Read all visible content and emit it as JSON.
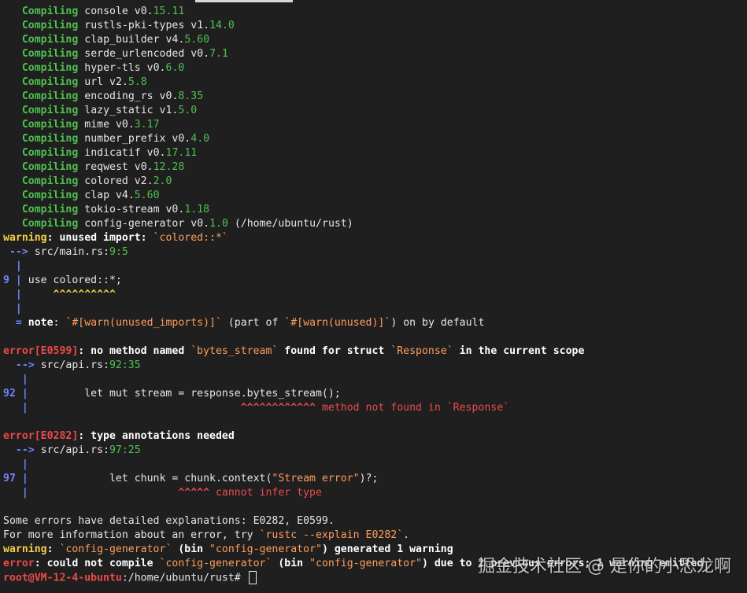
{
  "compile_lines": [
    {
      "word": "Compiling",
      "name": "console",
      "pre": "v0.",
      "post": "15.11"
    },
    {
      "word": "Compiling",
      "name": "rustls-pki-types",
      "pre": "v1.",
      "post": "14.0"
    },
    {
      "word": "Compiling",
      "name": "clap_builder",
      "pre": "v4.",
      "post": "5.60"
    },
    {
      "word": "Compiling",
      "name": "serde_urlencoded",
      "pre": "v0.",
      "post": "7.1"
    },
    {
      "word": "Compiling",
      "name": "hyper-tls",
      "pre": "v0.",
      "post": "6.0"
    },
    {
      "word": "Compiling",
      "name": "url",
      "pre": "v2.",
      "post": "5.8"
    },
    {
      "word": "Compiling",
      "name": "encoding_rs",
      "pre": "v0.",
      "post": "8.35"
    },
    {
      "word": "Compiling",
      "name": "lazy_static",
      "pre": "v1.",
      "post": "5.0"
    },
    {
      "word": "Compiling",
      "name": "mime",
      "pre": "v0.",
      "post": "3.17"
    },
    {
      "word": "Compiling",
      "name": "number_prefix",
      "pre": "v0.",
      "post": "4.0"
    },
    {
      "word": "Compiling",
      "name": "indicatif",
      "pre": "v0.",
      "post": "17.11"
    },
    {
      "word": "Compiling",
      "name": "reqwest",
      "pre": "v0.",
      "post": "12.28"
    },
    {
      "word": "Compiling",
      "name": "colored",
      "pre": "v2.",
      "post": "2.0"
    },
    {
      "word": "Compiling",
      "name": "clap",
      "pre": "v4.",
      "post": "5.60"
    },
    {
      "word": "Compiling",
      "name": "tokio-stream",
      "pre": "v0.",
      "post": "1.18"
    },
    {
      "word": "Compiling",
      "name": "config-generator",
      "pre": "v0.",
      "post": "1.0",
      "extra": " (/home/ubuntu/rust)"
    }
  ],
  "warning1": {
    "label": "warning",
    "msg": ": unused import: ",
    "code": "`colored::*`",
    "arrow": " --> ",
    "loc_file": "src/main.rs:",
    "loc_pos": "9:5",
    "gutter": "  |",
    "lineno": "9 | ",
    "src": "use colored::*;",
    "gutter2": "  |",
    "carets": "     ^^^^^^^^^^",
    "gutter3": "  |",
    "note_eq": "  = ",
    "note_label": "note",
    "note_a": ": ",
    "note_code1": "`#[warn(unused_imports)]`",
    "note_b": " (part of ",
    "note_code2": "`#[warn(unused)]`",
    "note_c": ") on by default"
  },
  "error1": {
    "label": "error[E0599]",
    "msg_a": ": no method named ",
    "code1": "`bytes_stream`",
    "msg_b": " found for struct ",
    "code2": "`Response`",
    "msg_c": " in the current scope",
    "arrow": "  --> ",
    "loc_file": "src/api.rs:",
    "loc_pos": "92:35",
    "gutter": "   |",
    "lineno": "92 | ",
    "src": "        let mut stream = response.bytes_stream();",
    "gutter2": "   |",
    "carets": "                                  ^^^^^^^^^^^^",
    "caret_msg": " method not found in `Response`"
  },
  "error2": {
    "label": "error[E0282]",
    "msg": ": type annotations needed",
    "arrow": "  --> ",
    "loc_file": "src/api.rs:",
    "loc_pos": "97:25",
    "gutter": "   |",
    "lineno": "97 | ",
    "src": "            let chunk = chunk.context(",
    "src_str": "\"Stream error\"",
    "src_end": ")?;",
    "gutter2": "   |",
    "carets": "                        ^^^^^",
    "caret_msg": " cannot infer type"
  },
  "summary": {
    "line1": "Some errors have detailed explanations: E0282, E0599.",
    "line2_a": "For more information about an error, try ",
    "line2_code": "`rustc --explain E0282`",
    "line2_b": ".",
    "warn_label": "warning",
    "warn_a": ": ",
    "warn_code": "`config-generator`",
    "warn_b": " (bin ",
    "warn_str": "\"config-generator\"",
    "warn_c": ") generated 1 warning",
    "err_label": "error",
    "err_a": ": could not compile ",
    "err_code": "`config-generator`",
    "err_b": " (bin ",
    "err_str": "\"config-generator\"",
    "err_c": ") due to 2 previous errors; 1 warning emitted"
  },
  "prompt": {
    "user": "root@VM-12-4-ubuntu",
    "path": ":/home/ubuntu/rust",
    "symbol": "# "
  },
  "watermark": "掘金技术社区 @ 是你的小恐龙啊"
}
